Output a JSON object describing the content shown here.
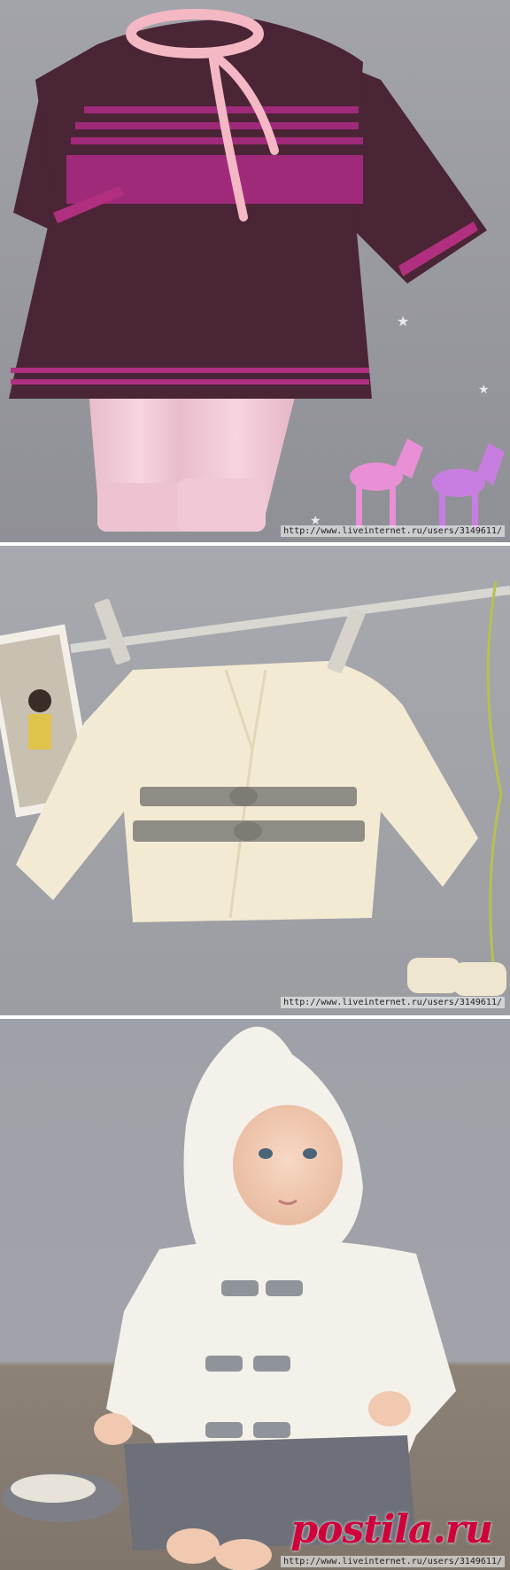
{
  "watermarks": {
    "dress_panel": "http://www.liveinternet.ru/users/3149611/",
    "jacket_panel": "http://www.liveinternet.ru/users/3149611/",
    "baby_panel": "http://www.liveinternet.ru/users/3149611/"
  },
  "brand": {
    "logo_text": "postila.ru"
  },
  "colors": {
    "background_grey": "#9a9ba0",
    "dress_plum": "#4a2535",
    "dress_stripe_magenta": "#a02a7a",
    "collar_pink": "#f4b8c4",
    "pants_pink": "#f1cad6",
    "jacket_cream": "#f3ead3",
    "belt_grey": "#8e8c85",
    "fleece_white": "#f4f1ea",
    "jeans_grey": "#6d7079",
    "brand_red": "#d0003a"
  }
}
